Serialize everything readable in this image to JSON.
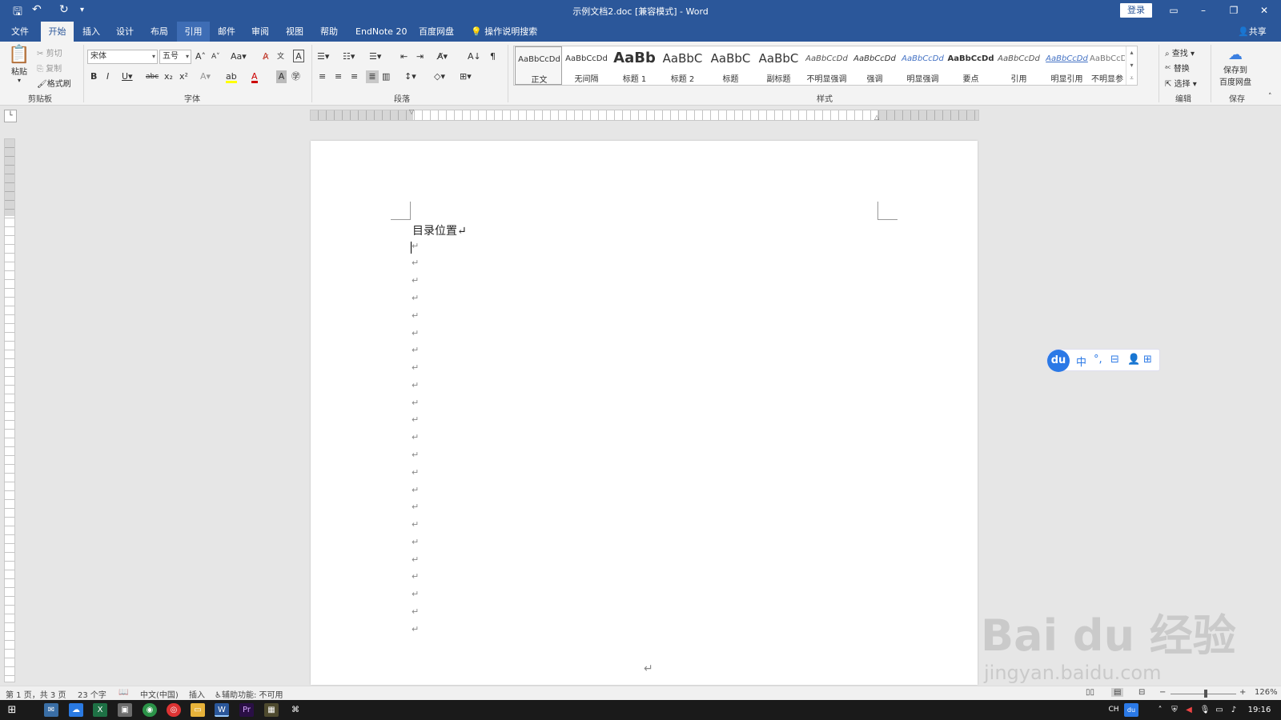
{
  "title_bar": {
    "document_title": "示例文档2.doc [兼容模式] - Word",
    "login_label": "登录",
    "quick_access": [
      "save-icon",
      "undo-icon",
      "redo-icon",
      "customize-icon"
    ]
  },
  "tabs": [
    "文件",
    "开始",
    "插入",
    "设计",
    "布局",
    "引用",
    "邮件",
    "审阅",
    "视图",
    "帮助",
    "EndNote 20",
    "百度网盘"
  ],
  "active_tab": "开始",
  "hover_tab": "引用",
  "tell_me": "操作说明搜索",
  "share_label": "共享",
  "clipboard": {
    "paste": "粘贴",
    "cut": "剪切",
    "copy": "复制",
    "format_painter": "格式刷",
    "label": "剪贴板"
  },
  "font": {
    "name": "宋体",
    "size": "五号",
    "label": "字体"
  },
  "paragraph": {
    "label": "段落"
  },
  "styles": {
    "label": "样式",
    "items": [
      {
        "preview": "AaBbCcDd",
        "name": "正文"
      },
      {
        "preview": "AaBbCcDd",
        "name": "无间隔"
      },
      {
        "preview": "AaBb",
        "name": "标题 1"
      },
      {
        "preview": "AaBbC",
        "name": "标题 2"
      },
      {
        "preview": "AaBbC",
        "name": "标题"
      },
      {
        "preview": "AaBbC",
        "name": "副标题"
      },
      {
        "preview": "AaBbCcDd",
        "name": "不明显强调"
      },
      {
        "preview": "AaBbCcDd",
        "name": "强调"
      },
      {
        "preview": "AaBbCcDd",
        "name": "明显强调"
      },
      {
        "preview": "AaBbCcDd",
        "name": "要点"
      },
      {
        "preview": "AaBbCcDd",
        "name": "引用"
      },
      {
        "preview": "AaBbCcDd",
        "name": "明显引用"
      },
      {
        "preview": "AaBbCcDd",
        "name": "不明显参考"
      }
    ]
  },
  "editing": {
    "find": "查找",
    "replace": "替换",
    "select": "选择",
    "label": "编辑"
  },
  "save": {
    "line1": "保存到",
    "line2": "百度网盘",
    "label": "保存"
  },
  "document": {
    "heading": "目录位置↵",
    "paragraph_mark": "↵",
    "end_mark": "↵"
  },
  "ime": {
    "logo": "du",
    "mode": "中"
  },
  "status": {
    "page": "第 1 页，共 3 页",
    "words": "23 个字",
    "language": "中文(中国)",
    "mode": "插入",
    "accessibility": "辅助功能: 不可用",
    "zoom": "126%"
  },
  "taskbar": {
    "time": "19:16",
    "ime_short": "CH"
  },
  "watermark": {
    "brand": "Bai du 经验",
    "url": "jingyan.baidu.com"
  },
  "colors": {
    "word_blue": "#2b579a",
    "ribbon_bg": "#f3f3f3",
    "canvas_bg": "#e6e6e6"
  }
}
